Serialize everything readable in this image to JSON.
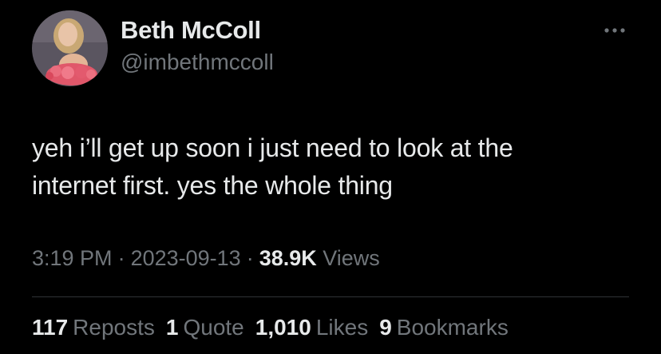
{
  "author": {
    "display_name": "Beth McColl",
    "handle": "@imbethmccoll",
    "avatar_icon": "profile-photo"
  },
  "more_icon": "ellipsis-icon",
  "tweet": {
    "text": "yeh i’ll get up soon i just need to look at the\ninternet first. yes the whole thing"
  },
  "meta": {
    "time": "3:19 PM",
    "separator": "·",
    "date": "2023-09-13",
    "views_count": "38.9K",
    "views_label": "Views"
  },
  "stats": {
    "reposts": {
      "count": "117",
      "label": "Reposts"
    },
    "quotes": {
      "count": "1",
      "label": "Quote"
    },
    "likes": {
      "count": "1,010",
      "label": "Likes"
    },
    "bookmarks": {
      "count": "9",
      "label": "Bookmarks"
    }
  },
  "colors": {
    "background": "#000000",
    "primary_text": "#e7e9ea",
    "secondary_text": "#71767b",
    "divider": "#2f3336"
  }
}
